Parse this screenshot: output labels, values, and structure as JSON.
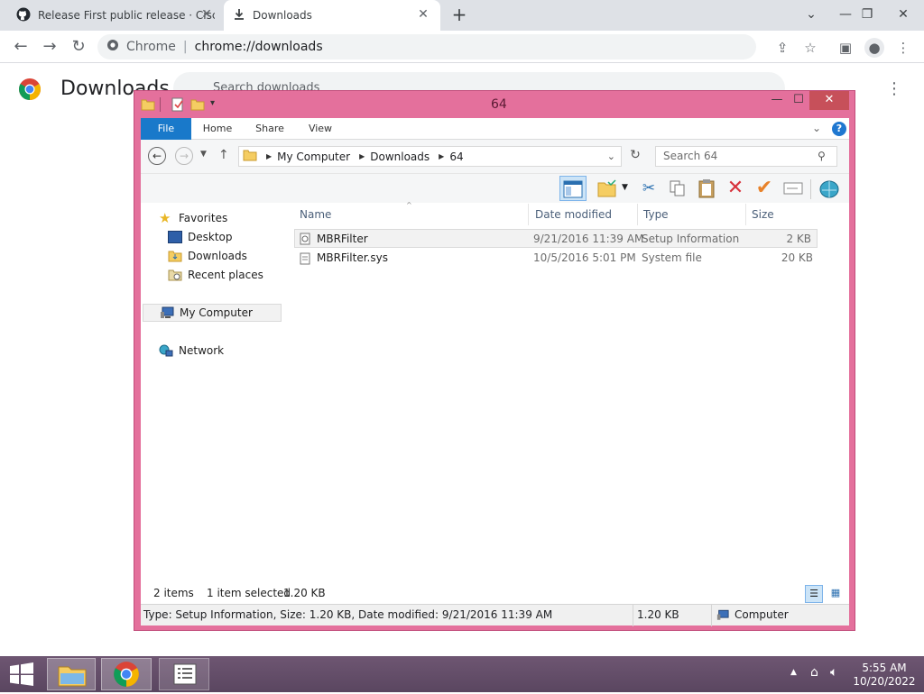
{
  "browser": {
    "tabs": [
      {
        "label": "Release First public release · Cisc",
        "icon": "github-icon",
        "active": false
      },
      {
        "label": "Downloads",
        "icon": "download-icon",
        "active": true
      }
    ],
    "omnibox": {
      "site_label": "Chrome",
      "url": "chrome://downloads"
    },
    "page": {
      "title": "Downloads",
      "search_placeholder": "Search downloads"
    }
  },
  "explorer": {
    "title": "64",
    "ribbon_tabs": [
      "File",
      "Home",
      "Share",
      "View"
    ],
    "breadcrumb": [
      "My Computer",
      "Downloads",
      "64"
    ],
    "search_placeholder": "Search 64",
    "nav": {
      "favorites": "Favorites",
      "favorite_items": [
        "Desktop",
        "Downloads",
        "Recent places"
      ],
      "computer": "My Computer",
      "network": "Network"
    },
    "columns": [
      "Name",
      "Date modified",
      "Type",
      "Size"
    ],
    "files": [
      {
        "name": "MBRFilter",
        "date": "9/21/2016 11:39 AM",
        "type": "Setup Information",
        "size": "2 KB",
        "selected": true
      },
      {
        "name": "MBRFilter.sys",
        "date": "10/5/2016 5:01 PM",
        "type": "System file",
        "size": "20 KB",
        "selected": false
      }
    ],
    "status": {
      "count": "2 items",
      "selection": "1 item selected",
      "selection_size": "1.20 KB"
    },
    "details": {
      "info": "Type: Setup Information, Size: 1.20 KB, Date modified: 9/21/2016 11:39 AM",
      "size": "1.20 KB",
      "location": "Computer"
    }
  },
  "taskbar": {
    "time": "5:55 AM",
    "date": "10/20/2022"
  },
  "colors": {
    "window_frame": "#e4709c",
    "file_tab": "#1979ca",
    "taskbar": "#6e5672"
  }
}
